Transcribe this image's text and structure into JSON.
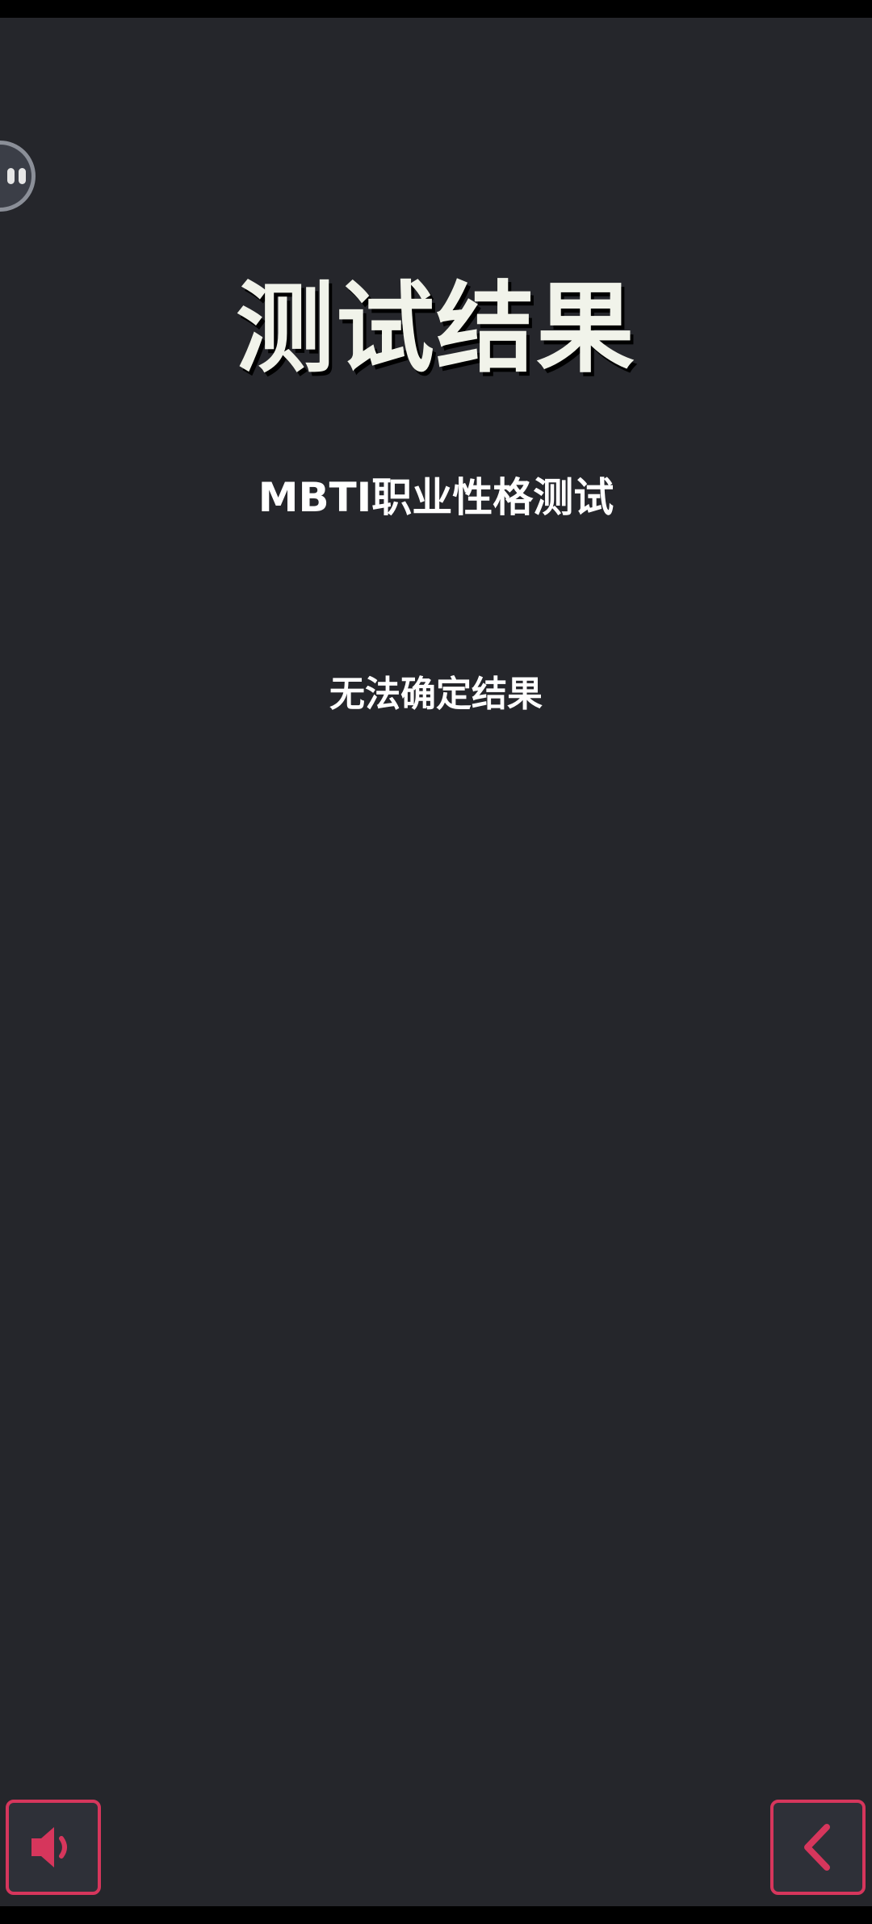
{
  "page": {
    "title": "测试结果",
    "subtitle": "MBTI职业性格测试",
    "result_text": "无法确定结果"
  },
  "controls": {
    "sound_icon": "speaker-icon",
    "back_icon": "chevron-left-icon",
    "floating_assistant_icon": "assistant-bubble-icon"
  },
  "colors": {
    "background": "#25262b",
    "accent": "#d6365c",
    "title_text": "#f1f3ea",
    "body_text": "#ffffff"
  }
}
